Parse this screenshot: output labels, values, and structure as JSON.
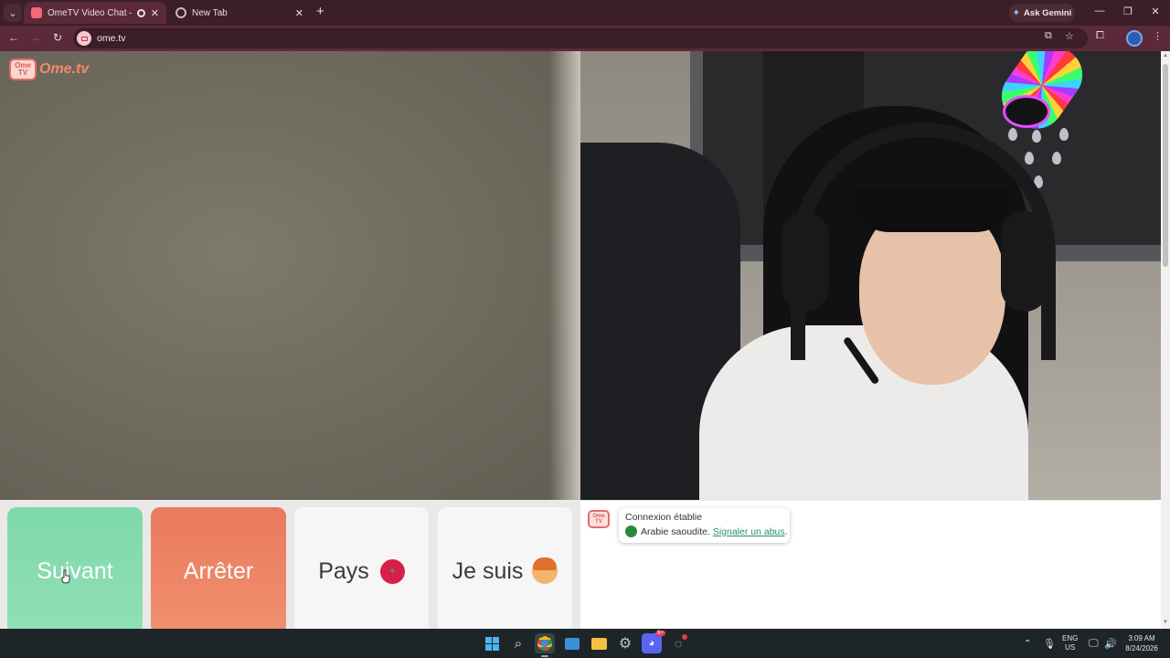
{
  "browser": {
    "tabs": [
      {
        "title": "OmeTV Video Chat — Omegl",
        "active": true
      },
      {
        "title": "New Tab",
        "active": false
      }
    ],
    "new_tab_glyph": "+",
    "close_glyph": "✕",
    "ask_gemini": "Ask Gemini",
    "url": "ome.tv",
    "window_controls": {
      "minimize": "—",
      "restore": "❐",
      "close": "✕"
    }
  },
  "site": {
    "logo_badge_line1": "Ome",
    "logo_badge_line2": "TV",
    "logo_text": "Ome.tv"
  },
  "controls": {
    "next_label": "Suivant",
    "stop_label": "Arrêter",
    "country_label": "Pays",
    "gender_label": "Je suis"
  },
  "chat": {
    "status": "Connexion établie",
    "country_text": "Arabie saoudite.",
    "report_link": "Signaler un abus",
    "trailing_period": "."
  },
  "taskbar": {
    "discord_badge": "9+",
    "lang_line1": "ENG",
    "lang_line2": "US",
    "time": "3:09 AM",
    "date": "8/24/2026"
  },
  "colors": {
    "next_button": "#7fd9aa",
    "stop_button": "#ea7a5d",
    "chrome_frame": "#5a2a3a",
    "link": "#2a8f6f"
  },
  "icons": [
    "tab-search-icon",
    "record-icon",
    "back-icon",
    "forward-icon",
    "reload-icon",
    "cast-icon",
    "bookmark-star-icon",
    "extensions-icon",
    "menu-dots-icon",
    "saudi-flag-icon",
    "boy-emoji-icon",
    "windows-start-icon",
    "search-icon",
    "chrome-icon",
    "file-explorer-icon",
    "settings-icon",
    "discord-icon"
  ]
}
